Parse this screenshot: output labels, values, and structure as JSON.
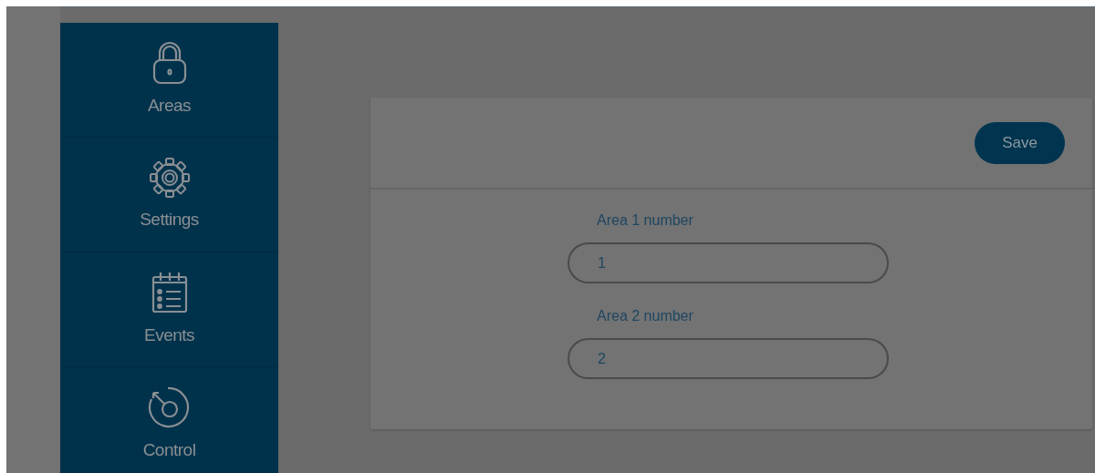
{
  "sidebar": {
    "items": [
      {
        "kind": "lock",
        "label": "Areas"
      },
      {
        "kind": "gear",
        "label": "Settings"
      },
      {
        "kind": "calendar",
        "label": "Events"
      },
      {
        "kind": "dial",
        "label": "Control"
      }
    ]
  },
  "card": {
    "save_button": "Save",
    "fields": [
      {
        "label": "Area 1 number",
        "value": "1"
      },
      {
        "label": "Area 2 number",
        "value": "2"
      }
    ]
  }
}
